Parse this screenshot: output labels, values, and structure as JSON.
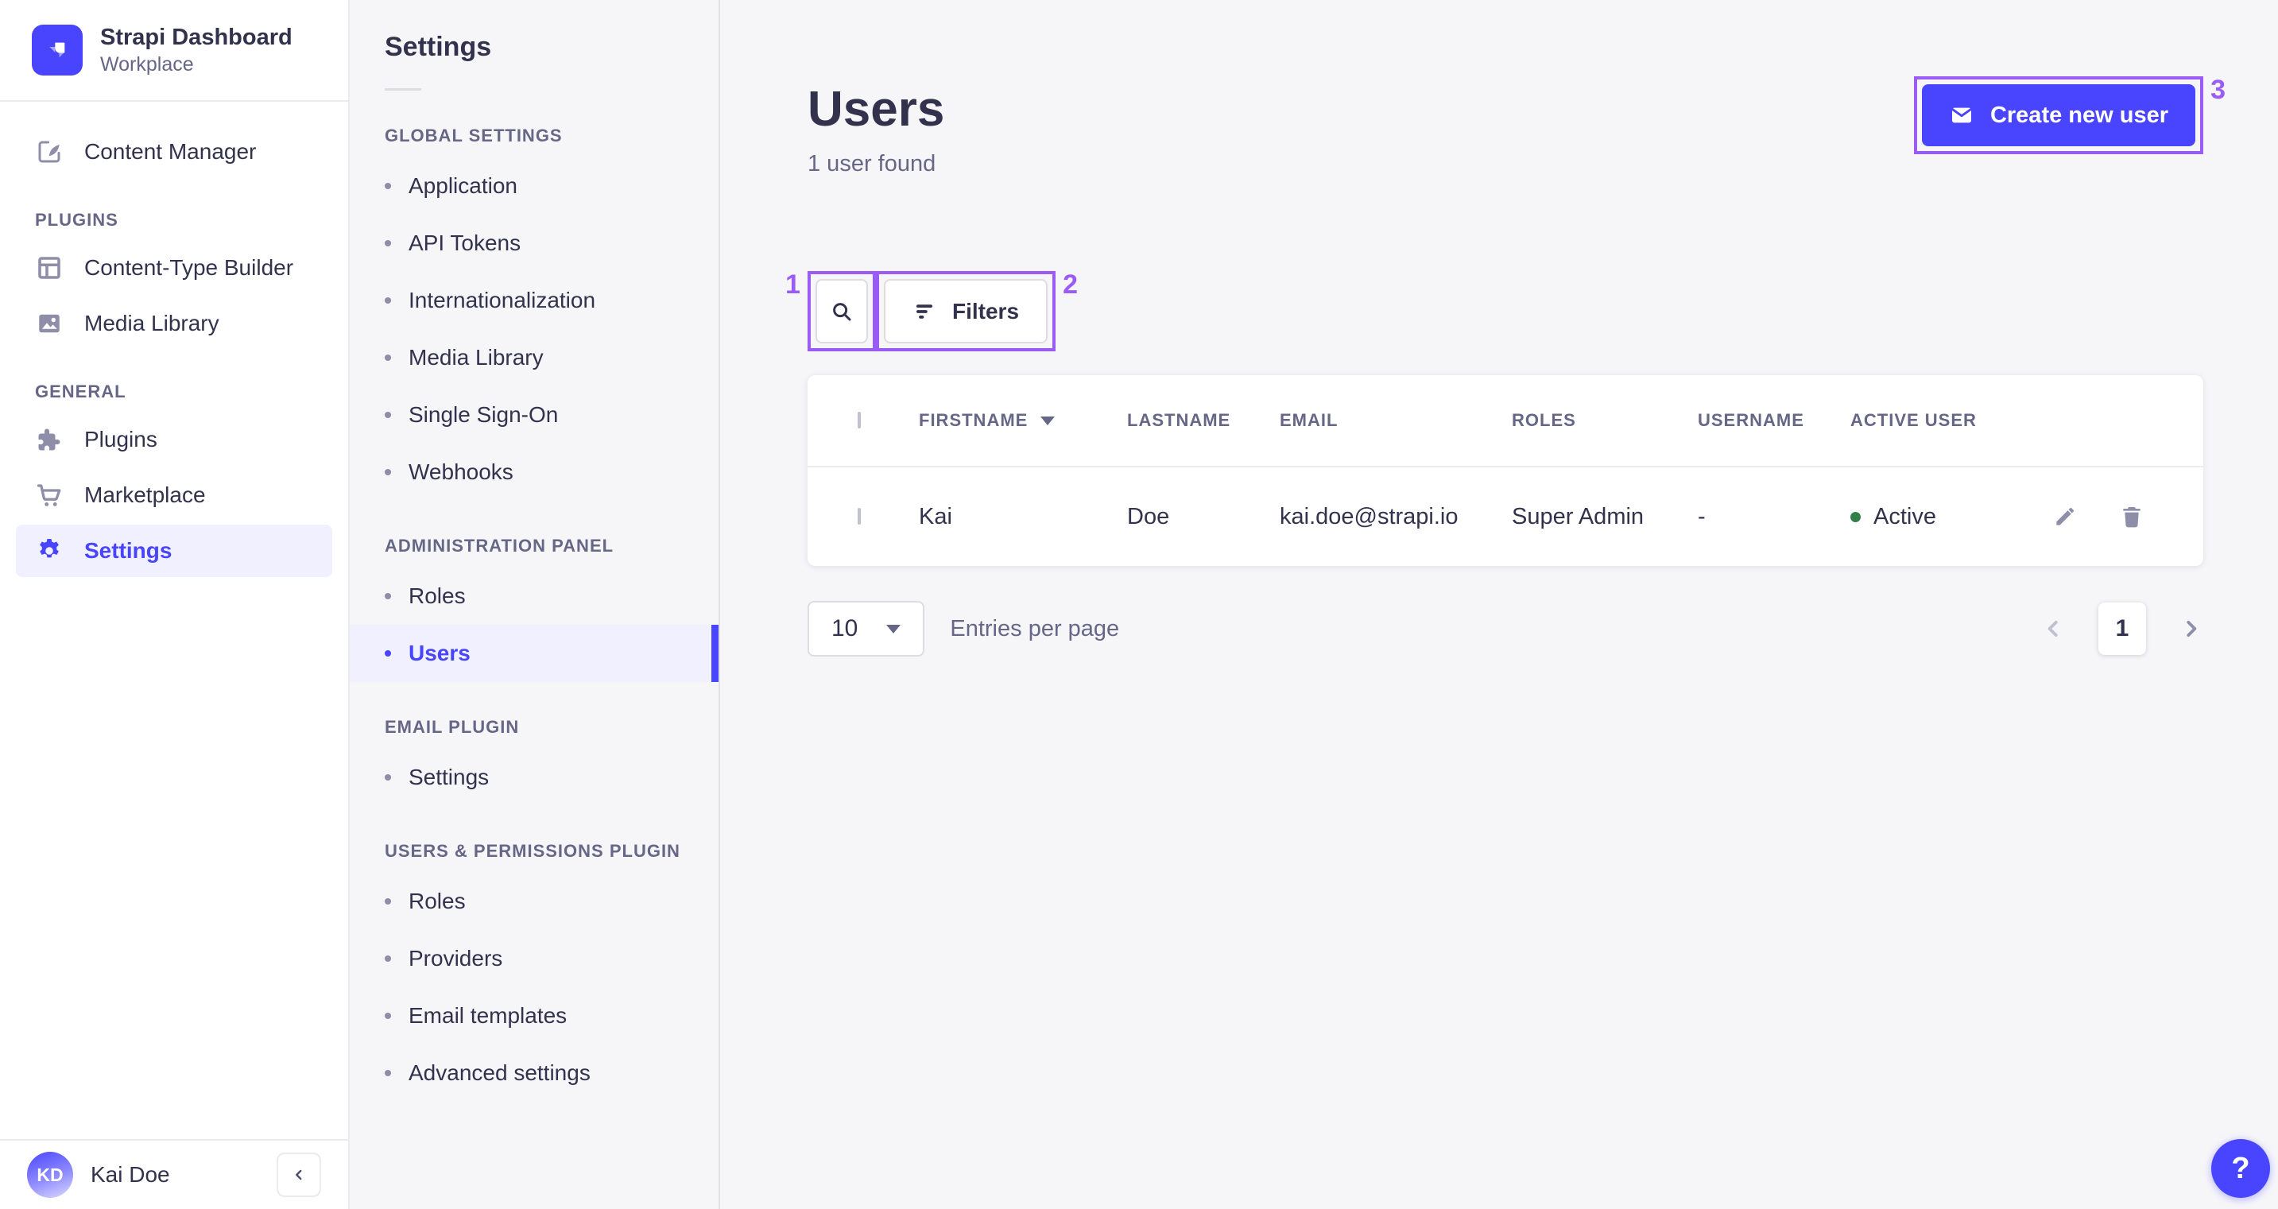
{
  "colors": {
    "accent": "#4945ff",
    "annotation": "#9a5cf5",
    "success": "#328048",
    "page_bg": "#f6f6f9"
  },
  "sidebar": {
    "brand": {
      "title": "Strapi Dashboard",
      "subtitle": "Workplace"
    },
    "content_manager": "Content Manager",
    "sections": [
      {
        "header": "PLUGINS",
        "items": [
          {
            "label": "Content-Type Builder",
            "icon": "layout-icon"
          },
          {
            "label": "Media Library",
            "icon": "picture-icon"
          }
        ]
      },
      {
        "header": "GENERAL",
        "items": [
          {
            "label": "Plugins",
            "icon": "puzzle-icon"
          },
          {
            "label": "Marketplace",
            "icon": "cart-icon"
          },
          {
            "label": "Settings",
            "icon": "gear-icon"
          }
        ]
      }
    ],
    "footer": {
      "user_initials": "KD",
      "user_name": "Kai Doe"
    }
  },
  "subnav": {
    "title": "Settings",
    "sections": [
      {
        "header": "GLOBAL SETTINGS",
        "items": [
          "Application",
          "API Tokens",
          "Internationalization",
          "Media Library",
          "Single Sign-On",
          "Webhooks"
        ]
      },
      {
        "header": "ADMINISTRATION PANEL",
        "items": [
          "Roles",
          "Users"
        ]
      },
      {
        "header": "EMAIL PLUGIN",
        "items": [
          "Settings"
        ]
      },
      {
        "header": "USERS & PERMISSIONS PLUGIN",
        "items": [
          "Roles",
          "Providers",
          "Email templates",
          "Advanced settings"
        ]
      }
    ]
  },
  "main": {
    "title": "Users",
    "subtitle": "1 user found",
    "create_button": "Create new user",
    "filters_button": "Filters",
    "table": {
      "headers": [
        "FIRSTNAME",
        "LASTNAME",
        "EMAIL",
        "ROLES",
        "USERNAME",
        "ACTIVE USER"
      ],
      "rows": [
        {
          "firstname": "Kai",
          "lastname": "Doe",
          "email": "kai.doe@strapi.io",
          "roles": "Super Admin",
          "username": "-",
          "active_status": "Active"
        }
      ]
    },
    "pagination": {
      "entries_value": "10",
      "entries_label": "Entries per page",
      "current_page": "1"
    }
  },
  "annotations": {
    "box1_label": "1",
    "box2_label": "2",
    "box3_label": "3"
  },
  "help_button": {
    "glyph": "?"
  },
  "icons": {
    "logo": "strapi-logo",
    "search": "magnifier",
    "filter": "funnel-bars",
    "create": "envelope",
    "edit": "pencil",
    "delete": "trash",
    "sort": "caret-down",
    "entries": "caret-down",
    "prev": "chevron-left",
    "next": "chevron-right",
    "collapse": "chevron-left",
    "help": "question-mark"
  }
}
